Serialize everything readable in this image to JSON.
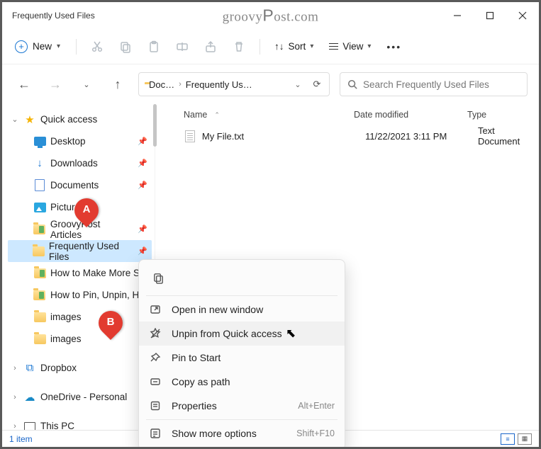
{
  "titlebar": {
    "title": "Frequently Used Files"
  },
  "watermark": "groovyPost.com",
  "toolbar": {
    "new_label": "New",
    "sort_label": "Sort",
    "view_label": "View"
  },
  "address": {
    "seg1": "Doc…",
    "seg2": "Frequently Us…"
  },
  "search": {
    "placeholder": "Search Frequently Used Files"
  },
  "columns": {
    "name": "Name",
    "date": "Date modified",
    "type": "Type"
  },
  "files": [
    {
      "name": "My File.txt",
      "date": "11/22/2021 3:11 PM",
      "type": "Text Document"
    }
  ],
  "sidebar": {
    "quick_access": "Quick access",
    "items": [
      {
        "label": "Desktop"
      },
      {
        "label": "Downloads"
      },
      {
        "label": "Documents"
      },
      {
        "label": "Pictures"
      },
      {
        "label": "GroovyPost Articles"
      },
      {
        "label": "Frequently Used Files"
      },
      {
        "label": "How to Make More Spa"
      },
      {
        "label": "How to Pin, Unpin, Hide"
      },
      {
        "label": "images"
      },
      {
        "label": "images"
      }
    ],
    "dropbox": "Dropbox",
    "onedrive": "OneDrive - Personal",
    "thispc": "This PC"
  },
  "context_menu": {
    "open_new_window": "Open in new window",
    "unpin": "Unpin from Quick access",
    "pin_start": "Pin to Start",
    "copy_path": "Copy as path",
    "properties": "Properties",
    "properties_shortcut": "Alt+Enter",
    "show_more": "Show more options",
    "show_more_shortcut": "Shift+F10"
  },
  "statusbar": {
    "count": "1 item"
  },
  "markers": {
    "a": "A",
    "b": "B"
  }
}
